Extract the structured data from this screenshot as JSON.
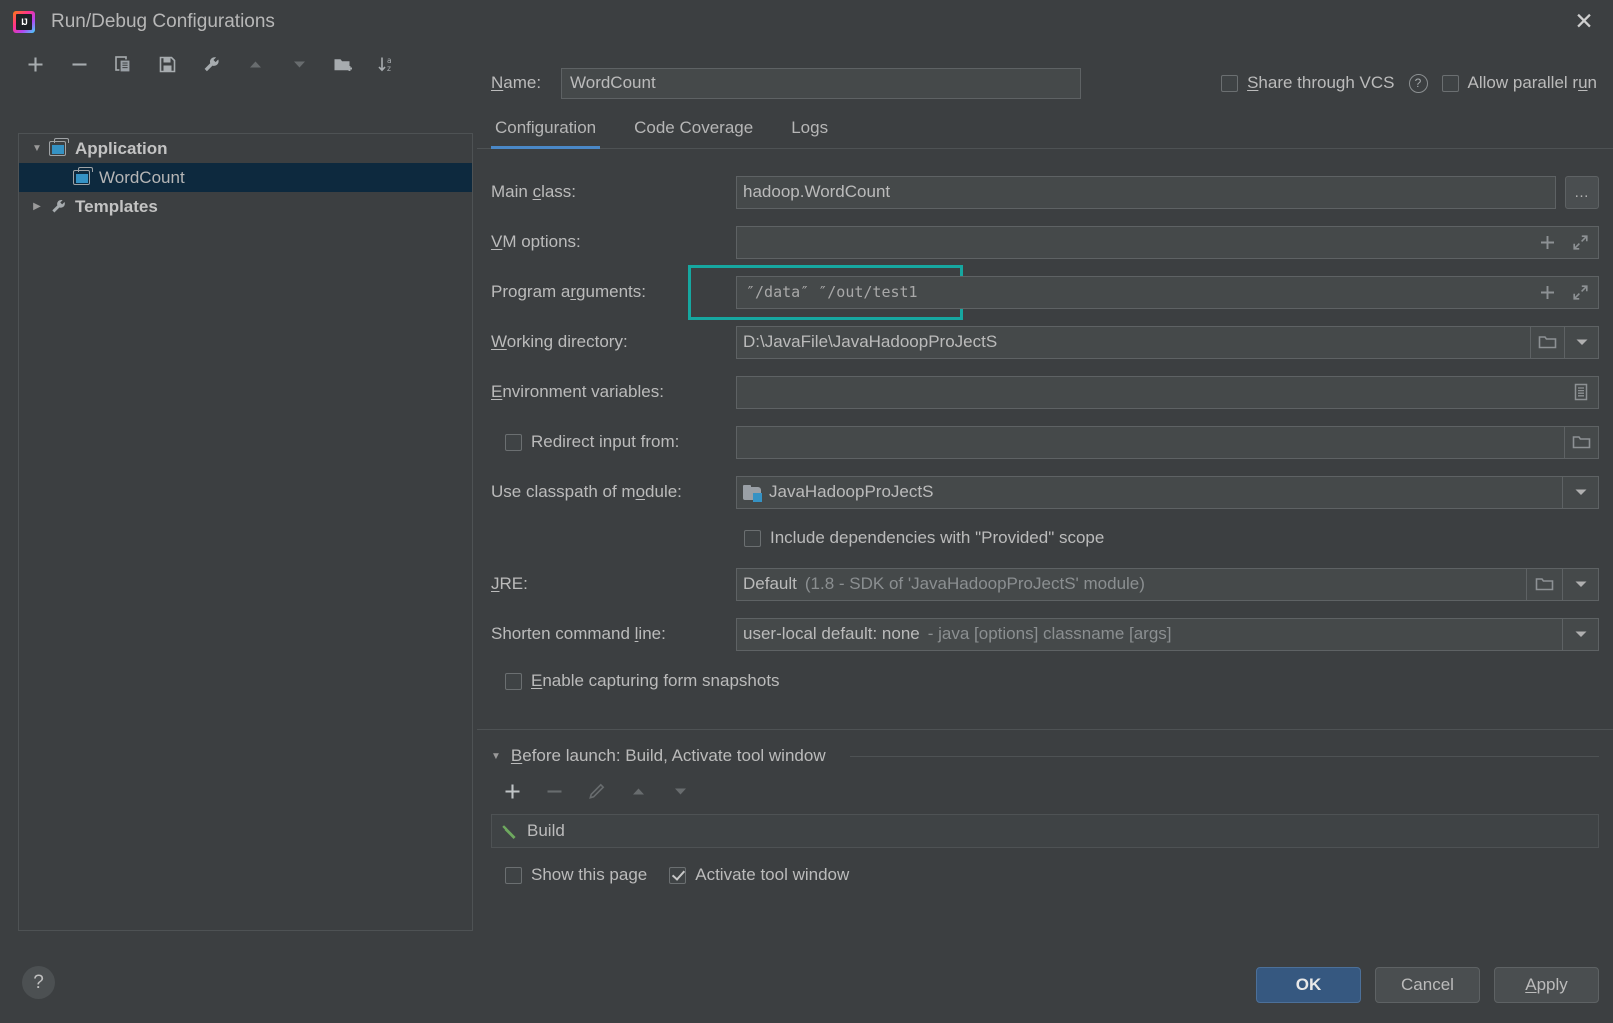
{
  "window": {
    "title": "Run/Debug Configurations",
    "logo_icon": "intellij-idea-logo",
    "close_icon": "close-icon"
  },
  "sidebar": {
    "toolbar": [
      {
        "icon": "add-icon",
        "label": "Add New Configuration"
      },
      {
        "icon": "remove-icon",
        "label": "Remove Configuration"
      },
      {
        "icon": "copy-icon",
        "label": "Copy Configuration"
      },
      {
        "icon": "save-icon",
        "label": "Save Configuration"
      },
      {
        "icon": "wrench-icon",
        "label": "Edit Templates"
      },
      {
        "icon": "arrow-up-icon",
        "label": "Move Up"
      },
      {
        "icon": "arrow-down-icon",
        "label": "Move Down"
      },
      {
        "icon": "new-folder-icon",
        "label": "Create New Folder"
      },
      {
        "icon": "sort-alphabetically-icon",
        "label": "Sort Configurations"
      }
    ],
    "tree": [
      {
        "label": "Application",
        "icon": "application-icon",
        "twisty": "▼",
        "type": "group",
        "selected": false
      },
      {
        "label": "WordCount",
        "icon": "application-icon",
        "twisty": "",
        "type": "child",
        "selected": true
      },
      {
        "label": "Templates",
        "icon": "wrench-icon",
        "twisty": "▶",
        "type": "group",
        "selected": false
      }
    ],
    "help_button": "?"
  },
  "header": {
    "name_label": "Name:",
    "name_label_mnemonic": "N",
    "name_label_rest": "ame:",
    "name_value": "WordCount",
    "share_vcs": {
      "label_mnemonic": "S",
      "label_rest": "hare through VCS",
      "checked": false
    },
    "help_icon": "?",
    "allow_parallel": {
      "label_pre": "Allow parallel r",
      "label_mnemonic": "u",
      "label_post": "n",
      "checked": false
    }
  },
  "tabs": [
    {
      "label": "Configuration",
      "active": true
    },
    {
      "label": "Code Coverage",
      "active": false
    },
    {
      "label": "Logs",
      "active": false
    }
  ],
  "form": {
    "main_class": {
      "label_pre": "Main ",
      "label_mnemonic": "c",
      "label_post": "lass:",
      "value": "hadoop.WordCount",
      "browse_label": "…",
      "browse_icon": "ellipsis-icon"
    },
    "vm_options": {
      "label_mnemonic": "V",
      "label_rest": "M options:",
      "value": "",
      "icons": [
        "add-macro-icon",
        "expand-icon"
      ]
    },
    "program_arguments": {
      "label_pre": "Program a",
      "label_mnemonic": "r",
      "label_post": "guments:",
      "value": "″/data″ ″/out/test1",
      "icons": [
        "add-macro-icon",
        "expand-icon"
      ],
      "highlight_color": "#16a7a0",
      "highlighted": true
    },
    "working_directory": {
      "label_mnemonic": "W",
      "label_rest": "orking directory:",
      "value": "D:\\JavaFile\\JavaHadoopProJectS",
      "icons": [
        "folder-icon",
        "chevron-down-icon"
      ]
    },
    "environment_variables": {
      "label_mnemonic": "E",
      "label_rest": "nvironment variables:",
      "value": "",
      "icons": [
        "list-editor-icon"
      ]
    },
    "redirect_input": {
      "label": "Redirect input from:",
      "checked": false,
      "value": "",
      "icons": [
        "folder-icon"
      ]
    },
    "classpath_module": {
      "label_pre": "Use classpath of m",
      "label_mnemonic": "o",
      "label_post": "dule:",
      "value": "JavaHadoopProJectS",
      "value_icon": "module-icon",
      "icons": [
        "chevron-down-icon"
      ]
    },
    "include_provided": {
      "label": "Include dependencies with \"Provided\" scope",
      "checked": false
    },
    "jre": {
      "label_mnemonic": "J",
      "label_rest": "RE:",
      "value": "Default",
      "value_hint": "(1.8 - SDK of 'JavaHadoopProJectS' module)",
      "icons": [
        "folder-icon",
        "chevron-down-icon"
      ]
    },
    "shorten_command_line": {
      "label_pre": "Shorten command ",
      "label_mnemonic": "l",
      "label_post": "ine:",
      "value": "user-local default: none",
      "value_hint": "- java [options] classname [args]",
      "icons": [
        "chevron-down-icon"
      ]
    },
    "form_snapshots": {
      "label_mnemonic": "E",
      "label_rest": "nable capturing form snapshots",
      "checked": false
    }
  },
  "before_launch": {
    "twisty": "▼",
    "title_mnemonic": "B",
    "title_rest": "efore launch: Build, Activate tool window",
    "toolbar": [
      {
        "icon": "add-icon",
        "enabled": true
      },
      {
        "icon": "remove-icon",
        "enabled": false
      },
      {
        "icon": "edit-pencil-icon",
        "enabled": false
      },
      {
        "icon": "arrow-up-icon",
        "enabled": false
      },
      {
        "icon": "arrow-down-icon",
        "enabled": false
      }
    ],
    "tasks": [
      {
        "label": "Build",
        "icon": "build-hammer-icon",
        "icon_color": "#6ea95f"
      }
    ],
    "show_this_page": {
      "label": "Show this page",
      "checked": false
    },
    "activate_tool_window": {
      "label": "Activate tool window",
      "checked": true
    }
  },
  "buttons": {
    "ok": "OK",
    "cancel": "Cancel",
    "apply_mnemonic": "A",
    "apply_rest": "pply"
  },
  "colors": {
    "window_bg": "#3c3f41",
    "field_bg": "#45494a",
    "border": "#5e6264",
    "accent_blue": "#4a88c7",
    "primary_button": "#365880",
    "selection": "#0d293e",
    "highlight_teal": "#16a7a0",
    "text": "#bbbbbb",
    "dim_text": "#8b8f91"
  }
}
